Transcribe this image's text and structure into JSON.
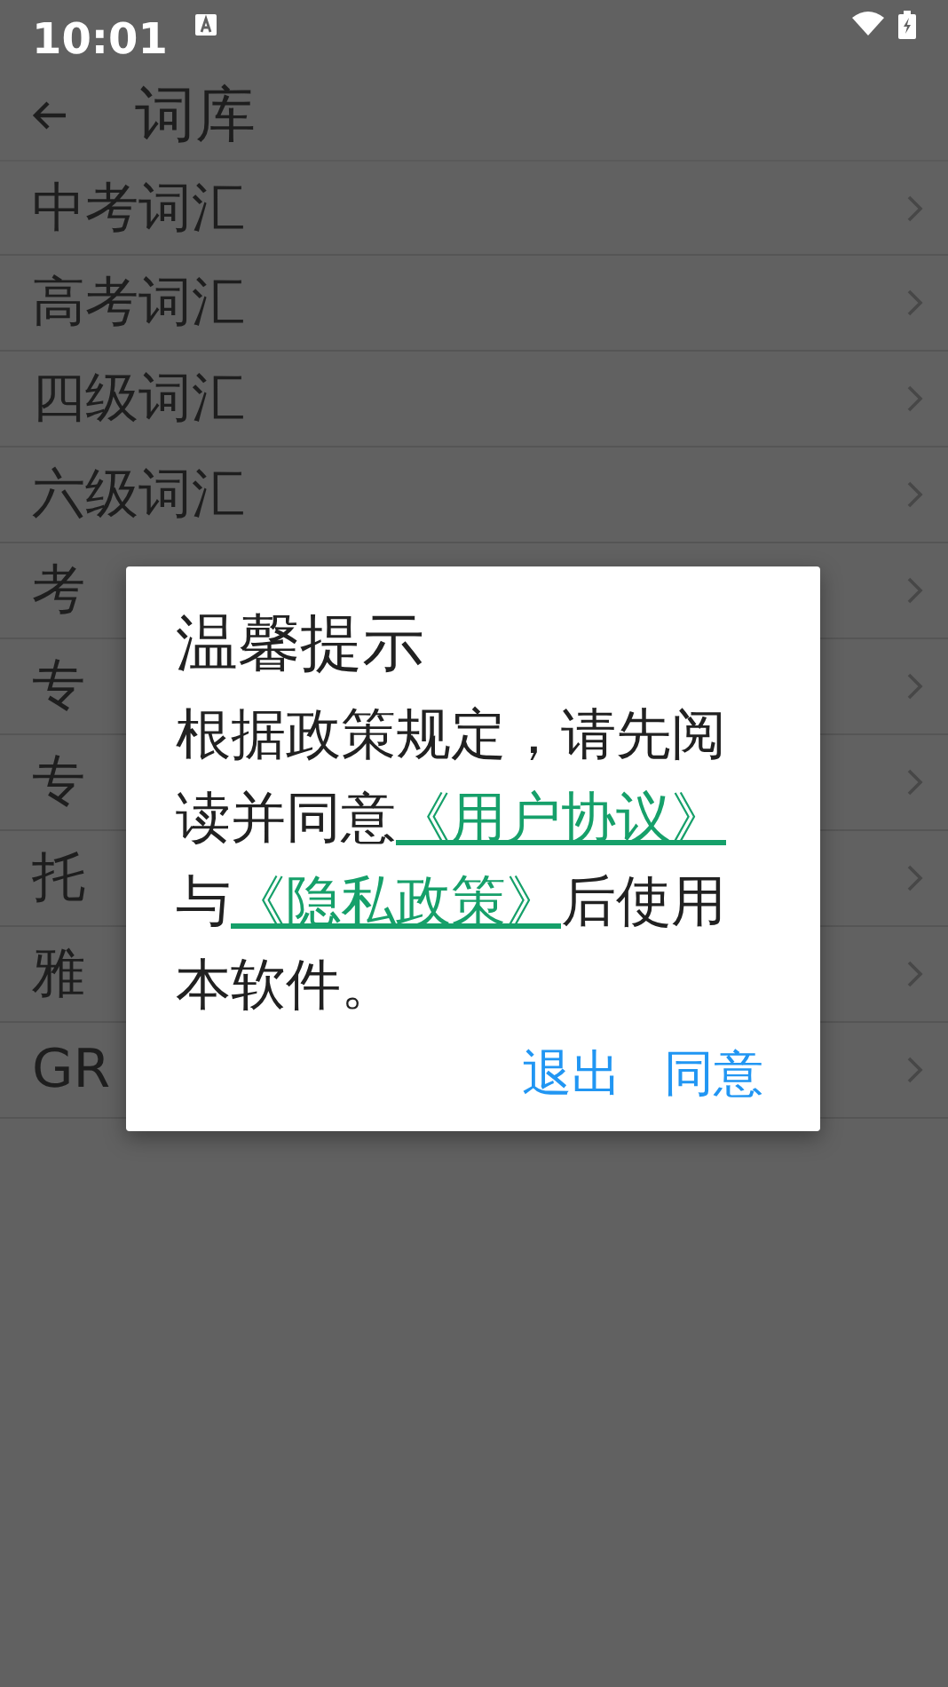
{
  "status_bar": {
    "time": "10:01"
  },
  "toolbar": {
    "title": "词库"
  },
  "list": [
    {
      "label": "中考词汇"
    },
    {
      "label": "高考词汇"
    },
    {
      "label": "四级词汇"
    },
    {
      "label": "六级词汇"
    },
    {
      "label": "考"
    },
    {
      "label": "专"
    },
    {
      "label": "专"
    },
    {
      "label": "托"
    },
    {
      "label": "雅"
    },
    {
      "label": "GR"
    }
  ],
  "dialog": {
    "title": "温馨提示",
    "message": [
      {
        "kind": "text",
        "text": "根据政策规定，请先阅读并同意"
      },
      {
        "kind": "link",
        "text": "《用户协议》"
      },
      {
        "kind": "text",
        "text": "与"
      },
      {
        "kind": "link",
        "text": "《隐私政策》"
      },
      {
        "kind": "text",
        "text": "后使用本软件。"
      }
    ],
    "buttons": [
      "退出",
      "同意"
    ]
  }
}
